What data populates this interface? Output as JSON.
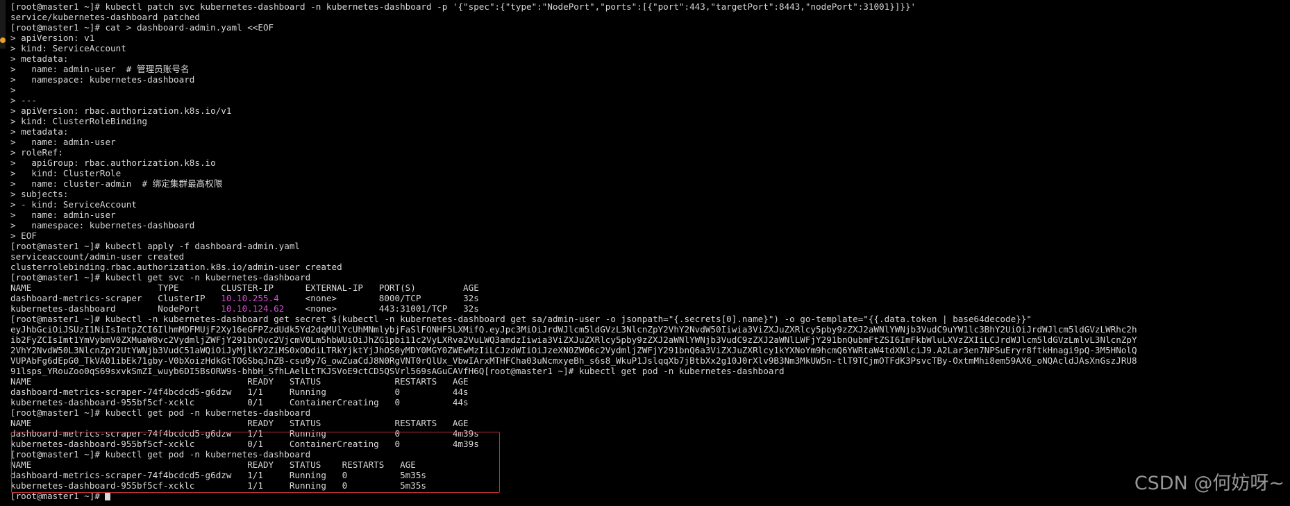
{
  "terminal": {
    "prompt": "[root@master1 ~]#",
    "lines": [
      {
        "segments": [
          {
            "text": "[root@master1 ~]# kubectl patch svc kubernetes-dashboard -n kubernetes-dashboard -p '{\"spec\":{\"type\":\"NodePort\",\"ports\":[{\"port\":443,\"targetPort\":8443,\"nodePort\":31001}]}}'"
          }
        ]
      },
      {
        "segments": [
          {
            "text": "service/kubernetes-dashboard patched"
          }
        ]
      },
      {
        "segments": [
          {
            "text": "[root@master1 ~]# cat > dashboard-admin.yaml <<EOF"
          }
        ]
      },
      {
        "segments": [
          {
            "text": "> apiVersion: v1"
          }
        ]
      },
      {
        "segments": [
          {
            "text": "> kind: ServiceAccount"
          }
        ]
      },
      {
        "segments": [
          {
            "text": "> metadata:"
          }
        ]
      },
      {
        "segments": [
          {
            "text": ">   name: admin-user  # 管理员账号名"
          }
        ]
      },
      {
        "segments": [
          {
            "text": ">   namespace: kubernetes-dashboard"
          }
        ]
      },
      {
        "segments": [
          {
            "text": ">"
          }
        ]
      },
      {
        "segments": [
          {
            "text": "> ---"
          }
        ]
      },
      {
        "segments": [
          {
            "text": "> apiVersion: rbac.authorization.k8s.io/v1"
          }
        ]
      },
      {
        "segments": [
          {
            "text": "> kind: ClusterRoleBinding"
          }
        ]
      },
      {
        "segments": [
          {
            "text": "> metadata:"
          }
        ]
      },
      {
        "segments": [
          {
            "text": ">   name: admin-user"
          }
        ]
      },
      {
        "segments": [
          {
            "text": "> roleRef:"
          }
        ]
      },
      {
        "segments": [
          {
            "text": ">   apiGroup: rbac.authorization.k8s.io"
          }
        ]
      },
      {
        "segments": [
          {
            "text": ">   kind: ClusterRole"
          }
        ]
      },
      {
        "segments": [
          {
            "text": ">   name: cluster-admin  # 绑定集群最高权限"
          }
        ]
      },
      {
        "segments": [
          {
            "text": "> subjects:"
          }
        ]
      },
      {
        "segments": [
          {
            "text": "> - kind: ServiceAccount"
          }
        ]
      },
      {
        "segments": [
          {
            "text": ">   name: admin-user"
          }
        ]
      },
      {
        "segments": [
          {
            "text": ">   namespace: kubernetes-dashboard"
          }
        ]
      },
      {
        "segments": [
          {
            "text": "> EOF"
          }
        ]
      },
      {
        "segments": [
          {
            "text": "[root@master1 ~]# kubectl apply -f dashboard-admin.yaml"
          }
        ]
      },
      {
        "segments": [
          {
            "text": "serviceaccount/admin-user created"
          }
        ]
      },
      {
        "segments": [
          {
            "text": "clusterrolebinding.rbac.authorization.k8s.io/admin-user created"
          }
        ]
      },
      {
        "segments": [
          {
            "text": "[root@master1 ~]# kubectl get svc -n kubernetes-dashboard"
          }
        ]
      },
      {
        "segments": [
          {
            "text": "NAME                        TYPE        CLUSTER-IP      EXTERNAL-IP   PORT(S)         AGE"
          }
        ]
      },
      {
        "segments": [
          {
            "text": "dashboard-metrics-scraper   ClusterIP   "
          },
          {
            "text": "10.10.255.4",
            "color": "magenta"
          },
          {
            "text": "     <none>        8000/TCP        32s"
          }
        ]
      },
      {
        "segments": [
          {
            "text": "kubernetes-dashboard        NodePort    "
          },
          {
            "text": "10.10.124.62",
            "color": "magenta"
          },
          {
            "text": "    <none>        443:31001/TCP   32s"
          }
        ]
      },
      {
        "segments": [
          {
            "text": "[root@master1 ~]# kubectl -n kubernetes-dashboard get secret $(kubectl -n kubernetes-dashboard get sa/admin-user -o jsonpath=\"{.secrets[0].name}\") -o go-template=\"{{.data.token | base64decode}}\""
          }
        ]
      },
      {
        "segments": [
          {
            "text": "eyJhbGciOiJSUzI1NiIsImtpZCI6IlhmMDFMUjF2Xy16eGFPZzdUdk5Yd2dqMUlYcUhMNmlybjFaSlFONHF5LXMifQ.eyJpc3MiOiJrdWJlcm5ldGVzL3NlcnZpY2VhY2NvdW50Iiwia3ViZXJuZXRlcy5pby9zZXJ2aWNlYWNjb3VudC9uYW1lc3BhY2UiOiJrdWJlcm5ldGVzLWRhc2h"
          }
        ]
      },
      {
        "segments": [
          {
            "text": "ib2FyZCIsImt1YmVybmV0ZXMuaW8vc2VydmljZWFjY291bnQvc2VjcmV0Lm5hbWUiOiJhZG1pbi11c2VyLXRva2VuLWQ3amdzIiwia3ViZXJuZXRlcy5pby9zZXJ2aWNlYWNjb3VudC9zZXJ2aWNlLWFjY291bnQubmFtZSI6ImFkbWluLXVzZXIiLCJrdWJlcm5ldGVzLmlvL3NlcnZpY"
          }
        ]
      },
      {
        "segments": [
          {
            "text": "2VhY2NvdW50L3NlcnZpY2UtYWNjb3VudC51aWQiOiJyMjlkY2ZiMS0xODdiLTRkYjktYjJhOS0yMDY0MGY0ZWEwMzIiLCJzdWIiOiJzeXN0ZW06c2VydmljZWFjY291bnQ6a3ViZXJuZXRlcy1kYXNoYm9hcmQ6YWRtaW4tdXNlciJ9.A2Lar3en7NPSuEryr8ftkHnagi9pQ-3M5HNolQ"
          }
        ]
      },
      {
        "segments": [
          {
            "text": "VUPAbFg6dEpG0_TkVA01ibEk71gby-V0bXoizHdkGtTOGSbqJnZB-csu9y7G_owZuaCdJ8N0RgVNT0rQlUx_VbwIArxMTHFCha03uNcmxyeBh_s6s8_WkuP1JslqqXb7jBtbXx2g10J0rXlv9B3Nm3MkUW5n-tlT9TCjmOTFdK3PsvcTBy-OxtmMhi8em59AX6_oNQAcldJAsXnGszJRU8"
          }
        ]
      },
      {
        "segments": [
          {
            "text": "91lsps_YRouZoo0qS69sxvkSmZI_wuyb6DI5BsORW9s-bhbH_SfhLAelLtTKJSVoE9ctCD5QSVrl569sAGuCAVfH6Q[root@master1 ~]# kubectl get pod -n kubernetes-dashboard"
          }
        ]
      },
      {
        "segments": [
          {
            "text": "NAME                                         READY   STATUS              RESTARTS   AGE"
          }
        ]
      },
      {
        "segments": [
          {
            "text": "dashboard-metrics-scraper-74f4bcdcd5-g6dzw   1/1     Running             0          44s"
          }
        ]
      },
      {
        "segments": [
          {
            "text": "kubernetes-dashboard-955bf5cf-xcklc          0/1     ContainerCreating   0          44s"
          }
        ]
      },
      {
        "segments": [
          {
            "text": "[root@master1 ~]# kubectl get pod -n kubernetes-dashboard"
          }
        ]
      },
      {
        "segments": [
          {
            "text": "NAME                                         READY   STATUS              RESTARTS   AGE"
          }
        ]
      },
      {
        "segments": [
          {
            "text": "dashboard-metrics-scraper-74f4bcdcd5-g6dzw   1/1     Running             0          4m39s"
          }
        ]
      },
      {
        "segments": [
          {
            "text": "kubernetes-dashboard-955bf5cf-xcklc          0/1     ContainerCreating   0          4m39s"
          }
        ]
      },
      {
        "segments": [
          {
            "text": "[root@master1 ~]# kubectl get pod -n kubernetes-dashboard"
          }
        ]
      },
      {
        "segments": [
          {
            "text": "NAME                                         READY   STATUS    RESTARTS   AGE"
          }
        ]
      },
      {
        "segments": [
          {
            "text": "dashboard-metrics-scraper-74f4bcdcd5-g6dzw   1/1     Running   0          5m35s"
          }
        ]
      },
      {
        "segments": [
          {
            "text": "kubernetes-dashboard-955bf5cf-xcklc          1/1     Running   0          5m35s"
          }
        ]
      },
      {
        "segments": [
          {
            "text": "[root@master1 ~]# "
          }
        ],
        "cursor": true
      }
    ]
  },
  "watermark": "CSDN @何妨呀~",
  "colors": {
    "background": "#000000",
    "foreground": "#d8d8d8",
    "ip_highlight": "#d84bd8",
    "annotation_box": "#c0303a"
  }
}
